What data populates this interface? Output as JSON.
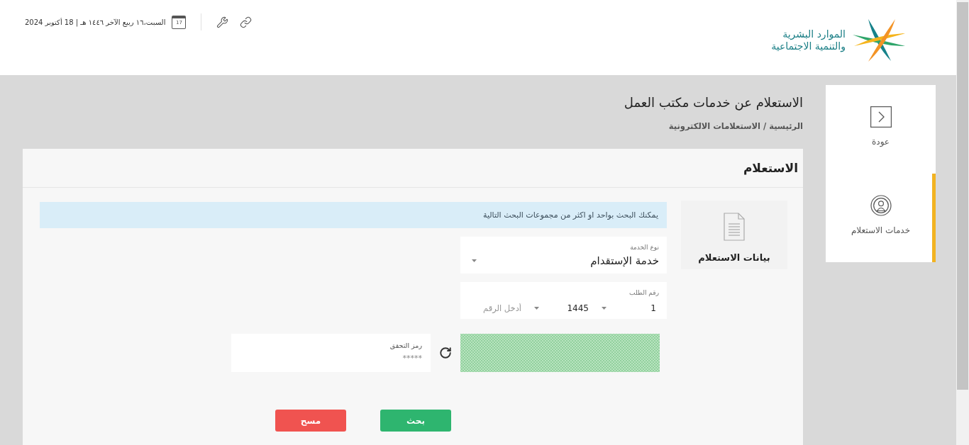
{
  "header": {
    "logo": {
      "lines": [
        "الموارد البشرية",
        "والتنمية الاجتماعية"
      ]
    },
    "calendar_day": "17",
    "date": "السبت،١٦ ربيع الآخر ١٤٤٦ هـ | 18 أكتوبر 2024"
  },
  "sidebar": {
    "items": [
      {
        "kind": "back",
        "label": "عودة",
        "selected": false
      },
      {
        "kind": "services",
        "label": "خدمات الاستعلام",
        "selected": true
      }
    ]
  },
  "page": {
    "title": "الاستعلام عن خدمات مكتب العمل",
    "breadcrumb": "الرئيسية / الاستعلامات الالكترونية"
  },
  "panel": {
    "title": "الاستعلام",
    "section": "بيانات الاستعلام",
    "notice": "يمكنك البحث بواحد او اكثر من مجموعات البحث التالية",
    "service_type": {
      "label": "نوع الخدمة",
      "value": "خدمة الإستقدام"
    },
    "request_number": {
      "label": "رقم الطلب",
      "parts": [
        {
          "kind": "select",
          "value": "1"
        },
        {
          "kind": "select",
          "value": "1445"
        },
        {
          "kind": "input",
          "placeholder": "أدخل الرقم"
        }
      ]
    },
    "captcha": {
      "label": "رمز التحقق",
      "placeholder": "*****"
    },
    "buttons": [
      {
        "kind": "primary",
        "label": "بحث"
      },
      {
        "kind": "danger",
        "label": "مسح"
      }
    ]
  }
}
